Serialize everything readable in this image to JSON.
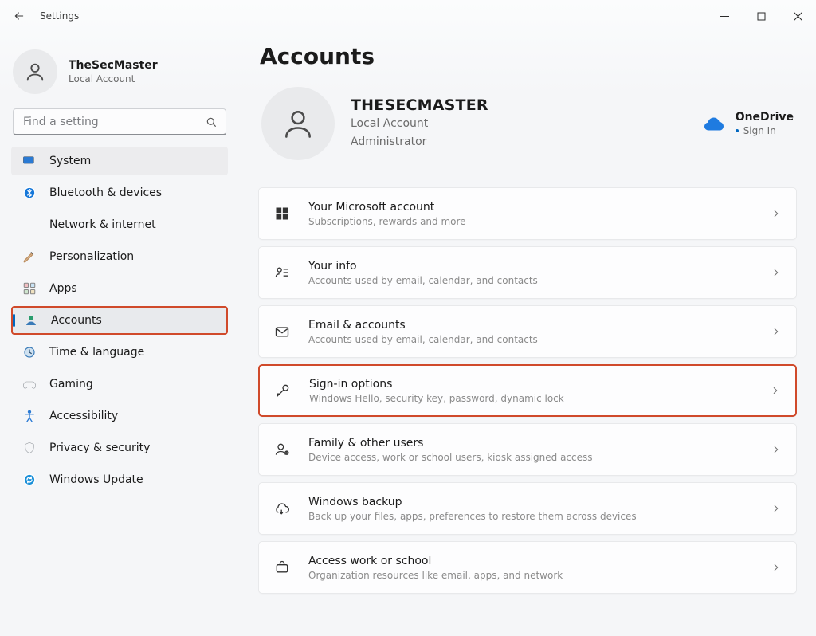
{
  "window": {
    "title": "Settings"
  },
  "user": {
    "display_name": "TheSecMaster",
    "subtitle": "Local Account"
  },
  "search": {
    "placeholder": "Find a setting"
  },
  "sidebar": {
    "items": [
      {
        "icon": "system",
        "label": "System"
      },
      {
        "icon": "bluetooth",
        "label": "Bluetooth & devices"
      },
      {
        "icon": "network",
        "label": "Network & internet"
      },
      {
        "icon": "personalize",
        "label": "Personalization"
      },
      {
        "icon": "apps",
        "label": "Apps"
      },
      {
        "icon": "accounts",
        "label": "Accounts"
      },
      {
        "icon": "time",
        "label": "Time & language"
      },
      {
        "icon": "gaming",
        "label": "Gaming"
      },
      {
        "icon": "accessibility",
        "label": "Accessibility"
      },
      {
        "icon": "privacy",
        "label": "Privacy & security"
      },
      {
        "icon": "update",
        "label": "Windows Update"
      }
    ],
    "hover_index": 0,
    "selected_index": 5,
    "highlight_index": 5
  },
  "page": {
    "title": "Accounts",
    "account": {
      "name": "THESECMASTER",
      "line1": "Local Account",
      "line2": "Administrator"
    },
    "onedrive": {
      "label": "OneDrive",
      "action": "Sign In"
    },
    "cards": [
      {
        "icon": "msaccount",
        "title": "Your Microsoft account",
        "subtitle": "Subscriptions, rewards and more"
      },
      {
        "icon": "yourinfo",
        "title": "Your info",
        "subtitle": "Accounts used by email, calendar, and contacts"
      },
      {
        "icon": "email",
        "title": "Email & accounts",
        "subtitle": "Accounts used by email, calendar, and contacts"
      },
      {
        "icon": "signin",
        "title": "Sign-in options",
        "subtitle": "Windows Hello, security key, password, dynamic lock"
      },
      {
        "icon": "family",
        "title": "Family & other users",
        "subtitle": "Device access, work or school users, kiosk assigned access"
      },
      {
        "icon": "backup",
        "title": "Windows backup",
        "subtitle": "Back up your files, apps, preferences to restore them across devices"
      },
      {
        "icon": "work",
        "title": "Access work or school",
        "subtitle": "Organization resources like email, apps, and network"
      }
    ],
    "highlight_card_index": 3
  }
}
